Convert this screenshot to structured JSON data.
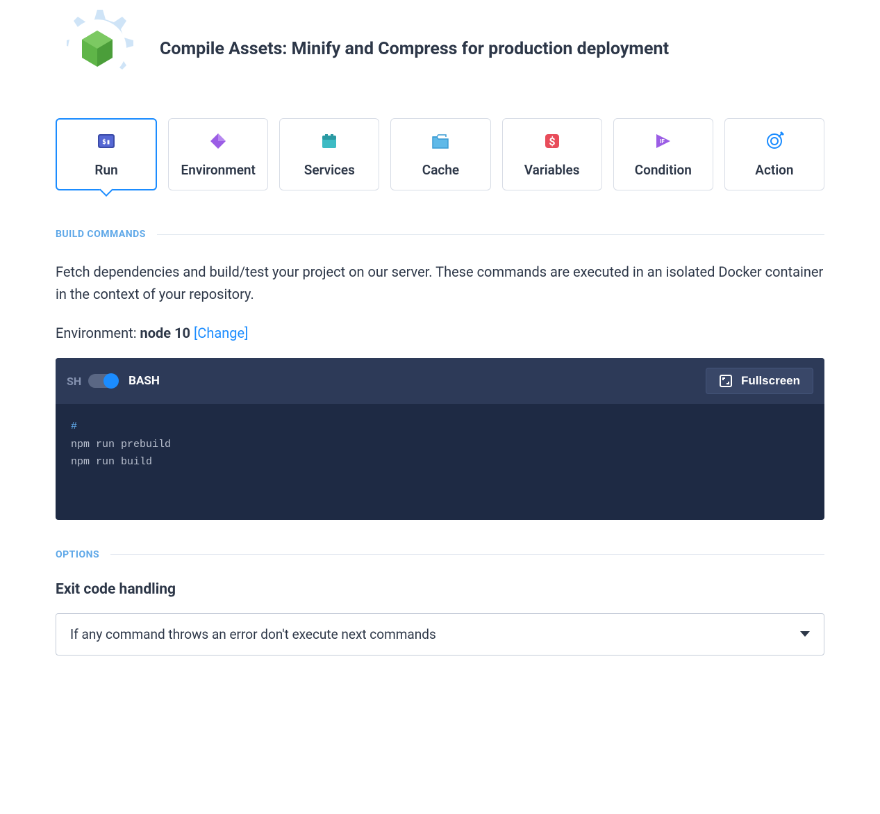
{
  "header": {
    "title": "Compile Assets: Minify and Compress for production deployment"
  },
  "tabs": [
    {
      "id": "run",
      "label": "Run",
      "active": true
    },
    {
      "id": "environment",
      "label": "Environment",
      "active": false
    },
    {
      "id": "services",
      "label": "Services",
      "active": false
    },
    {
      "id": "cache",
      "label": "Cache",
      "active": false
    },
    {
      "id": "variables",
      "label": "Variables",
      "active": false
    },
    {
      "id": "condition",
      "label": "Condition",
      "active": false
    },
    {
      "id": "action",
      "label": "Action",
      "active": false
    }
  ],
  "build": {
    "section_label": "BUILD COMMANDS",
    "description": "Fetch dependencies and build/test your project on our server. These commands are executed in an isolated Docker container in the context of your repository.",
    "env_label": "Environment: ",
    "env_value": "node 10",
    "change_label": "[Change]",
    "shell": {
      "sh_label": "SH",
      "bash_label": "BASH",
      "bash_selected": true,
      "fullscreen_label": "Fullscreen",
      "code_comment": "#",
      "code_lines": "npm run prebuild\nnpm run build"
    }
  },
  "options": {
    "section_label": "OPTIONS",
    "exit_title": "Exit code handling",
    "selected": "If any command throws an error don't execute next commands"
  },
  "colors": {
    "accent": "#1b8cff",
    "code_bg": "#1e2a44"
  }
}
